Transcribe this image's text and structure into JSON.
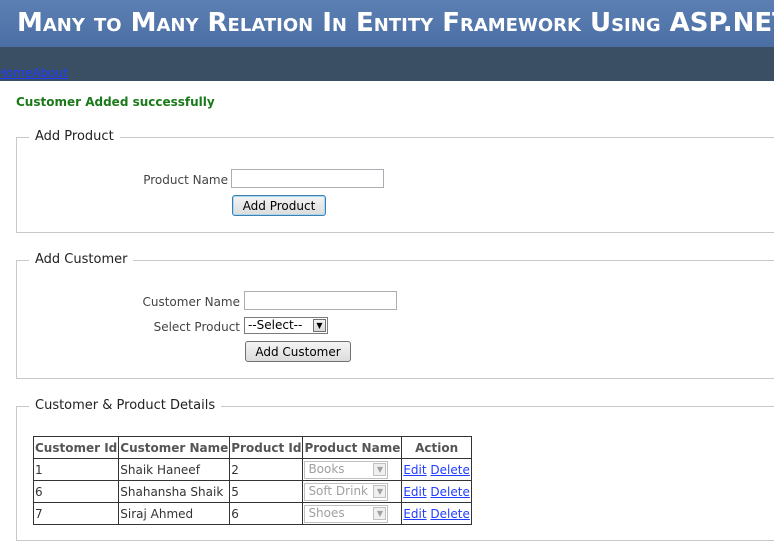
{
  "header": {
    "title": "Many to Many Relation In Entity Framework Using ASP.NET"
  },
  "nav": {
    "home": "Home",
    "about": "About"
  },
  "message": "Customer Added successfully",
  "add_product": {
    "legend": "Add Product",
    "name_label": "Product Name",
    "name_value": "",
    "button": "Add Product"
  },
  "add_customer": {
    "legend": "Add Customer",
    "name_label": "Customer Name",
    "name_value": "",
    "product_label": "Select Product",
    "product_selected": "--Select--",
    "button": "Add Customer"
  },
  "details": {
    "legend": "Customer & Product Details",
    "columns": [
      "Customer Id",
      "Customer Name",
      "Product Id",
      "Product Name",
      "Action"
    ],
    "rows": [
      {
        "customer_id": "1",
        "customer_name": "Shaik Haneef",
        "product_id": "2",
        "product_name": "Books",
        "edit": "Edit",
        "delete": "Delete"
      },
      {
        "customer_id": "6",
        "customer_name": "Shahansha Shaik",
        "product_id": "5",
        "product_name": "Soft Drink",
        "edit": "Edit",
        "delete": "Delete"
      },
      {
        "customer_id": "7",
        "customer_name": "Siraj Ahmed",
        "product_id": "6",
        "product_name": "Shoes",
        "edit": "Edit",
        "delete": "Delete"
      }
    ]
  },
  "colors": {
    "header_bg": "#4b6fa5",
    "nav_bg": "#3a4f63",
    "success": "#1a7a1a",
    "link": "#1f3cff"
  }
}
